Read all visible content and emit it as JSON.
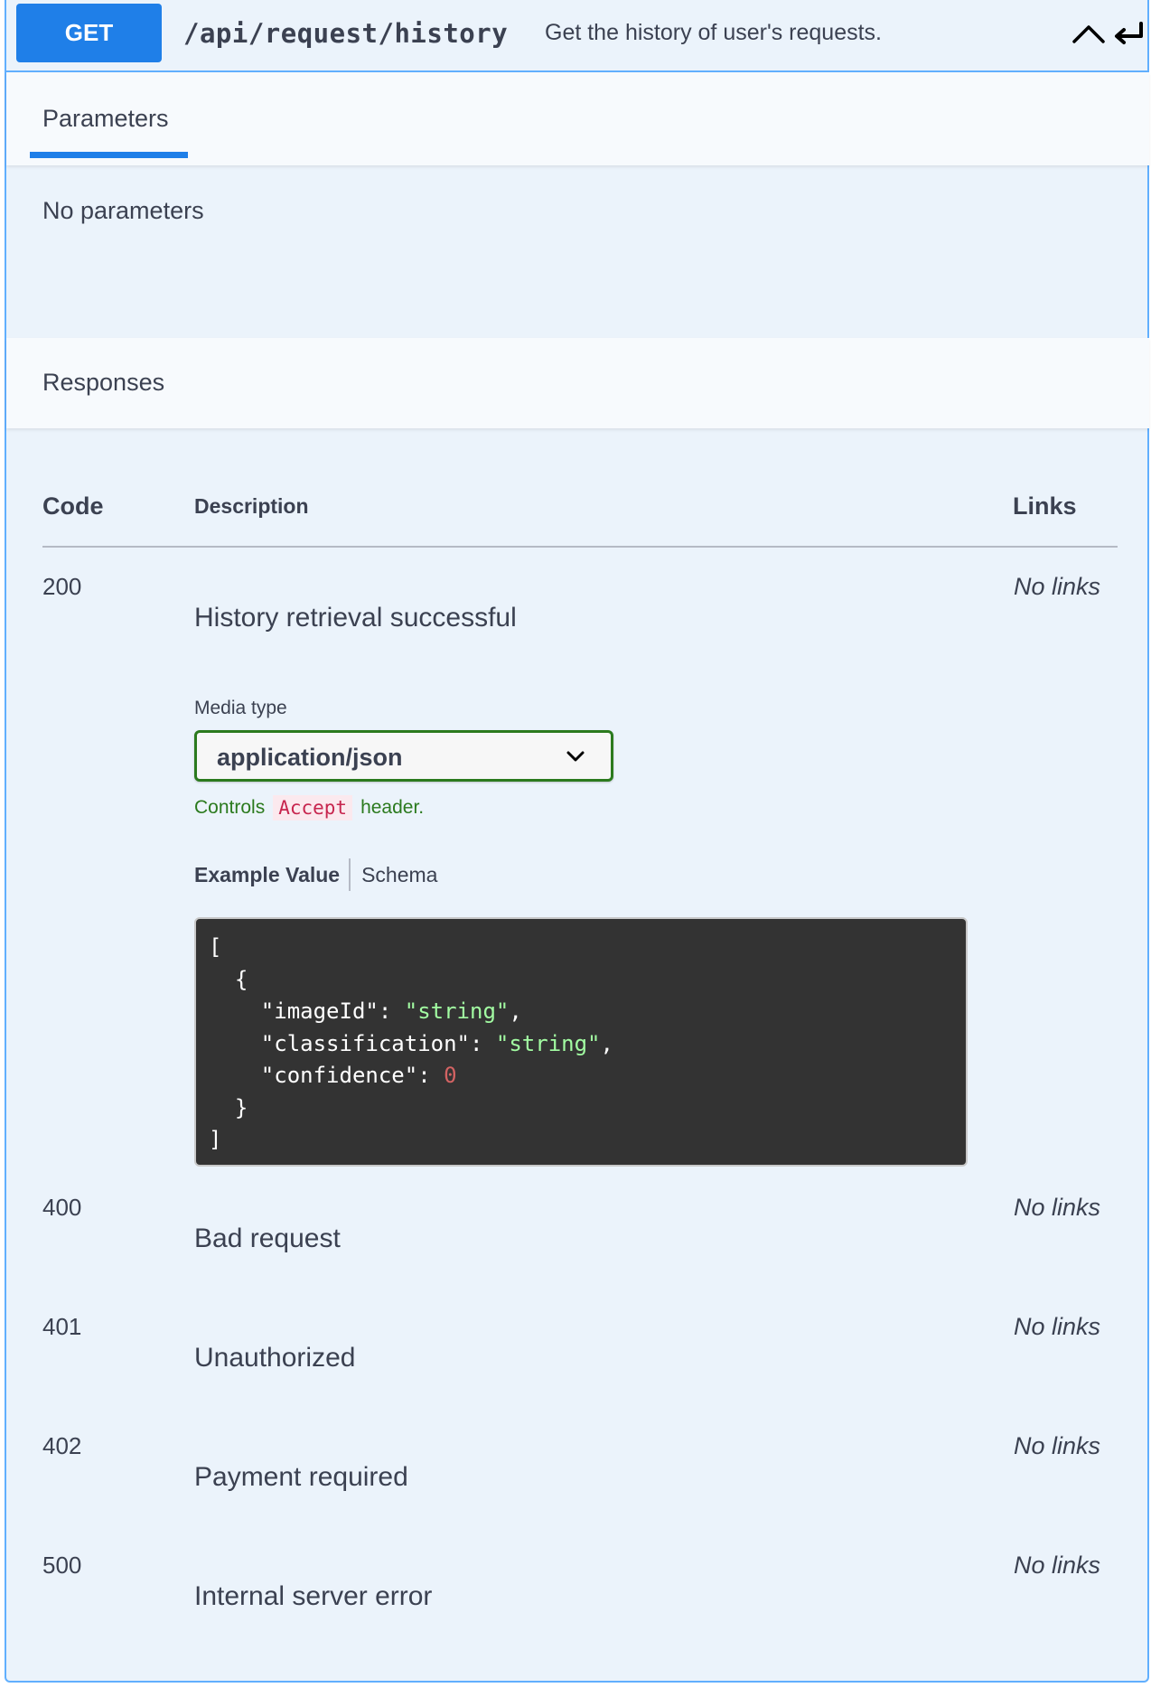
{
  "endpoint": {
    "method": "GET",
    "path": "/api/request/history",
    "summary": "Get the history of user's requests."
  },
  "tabs": {
    "parameters_label": "Parameters",
    "no_parameters": "No parameters"
  },
  "responses": {
    "title": "Responses",
    "headers": {
      "code": "Code",
      "description": "Description",
      "links": "Links"
    },
    "rows": [
      {
        "code": "200",
        "description": "History retrieval successful",
        "links": "No links"
      },
      {
        "code": "400",
        "description": "Bad request",
        "links": "No links"
      },
      {
        "code": "401",
        "description": "Unauthorized",
        "links": "No links"
      },
      {
        "code": "402",
        "description": "Payment required",
        "links": "No links"
      },
      {
        "code": "500",
        "description": "Internal server error",
        "links": "No links"
      }
    ],
    "media_type": {
      "label": "Media type",
      "selected": "application/json",
      "controls_prefix": "Controls",
      "controls_code": "Accept",
      "controls_suffix": "header."
    },
    "example_tabs": {
      "example": "Example Value",
      "schema": "Schema"
    },
    "example": {
      "open_bracket": "[",
      "open_brace": "  {",
      "fields": [
        {
          "key": "\"imageId\"",
          "value": "\"string\"",
          "type": "string",
          "comma": ","
        },
        {
          "key": "\"classification\"",
          "value": "\"string\"",
          "type": "string",
          "comma": ","
        },
        {
          "key": "\"confidence\"",
          "value": "0",
          "type": "number",
          "comma": ""
        }
      ],
      "close_brace": "  }",
      "close_bracket": "]"
    }
  },
  "colors": {
    "method_bg": "#1f7fe8",
    "block_bg": "#ebf3fb",
    "block_border": "#61affe",
    "select_border": "#2b7a1e",
    "json_string": "#a2fca2",
    "json_number": "#d36363"
  },
  "icons": [
    "chevron-up-icon",
    "return-arrow-icon",
    "chevron-down-icon"
  ]
}
